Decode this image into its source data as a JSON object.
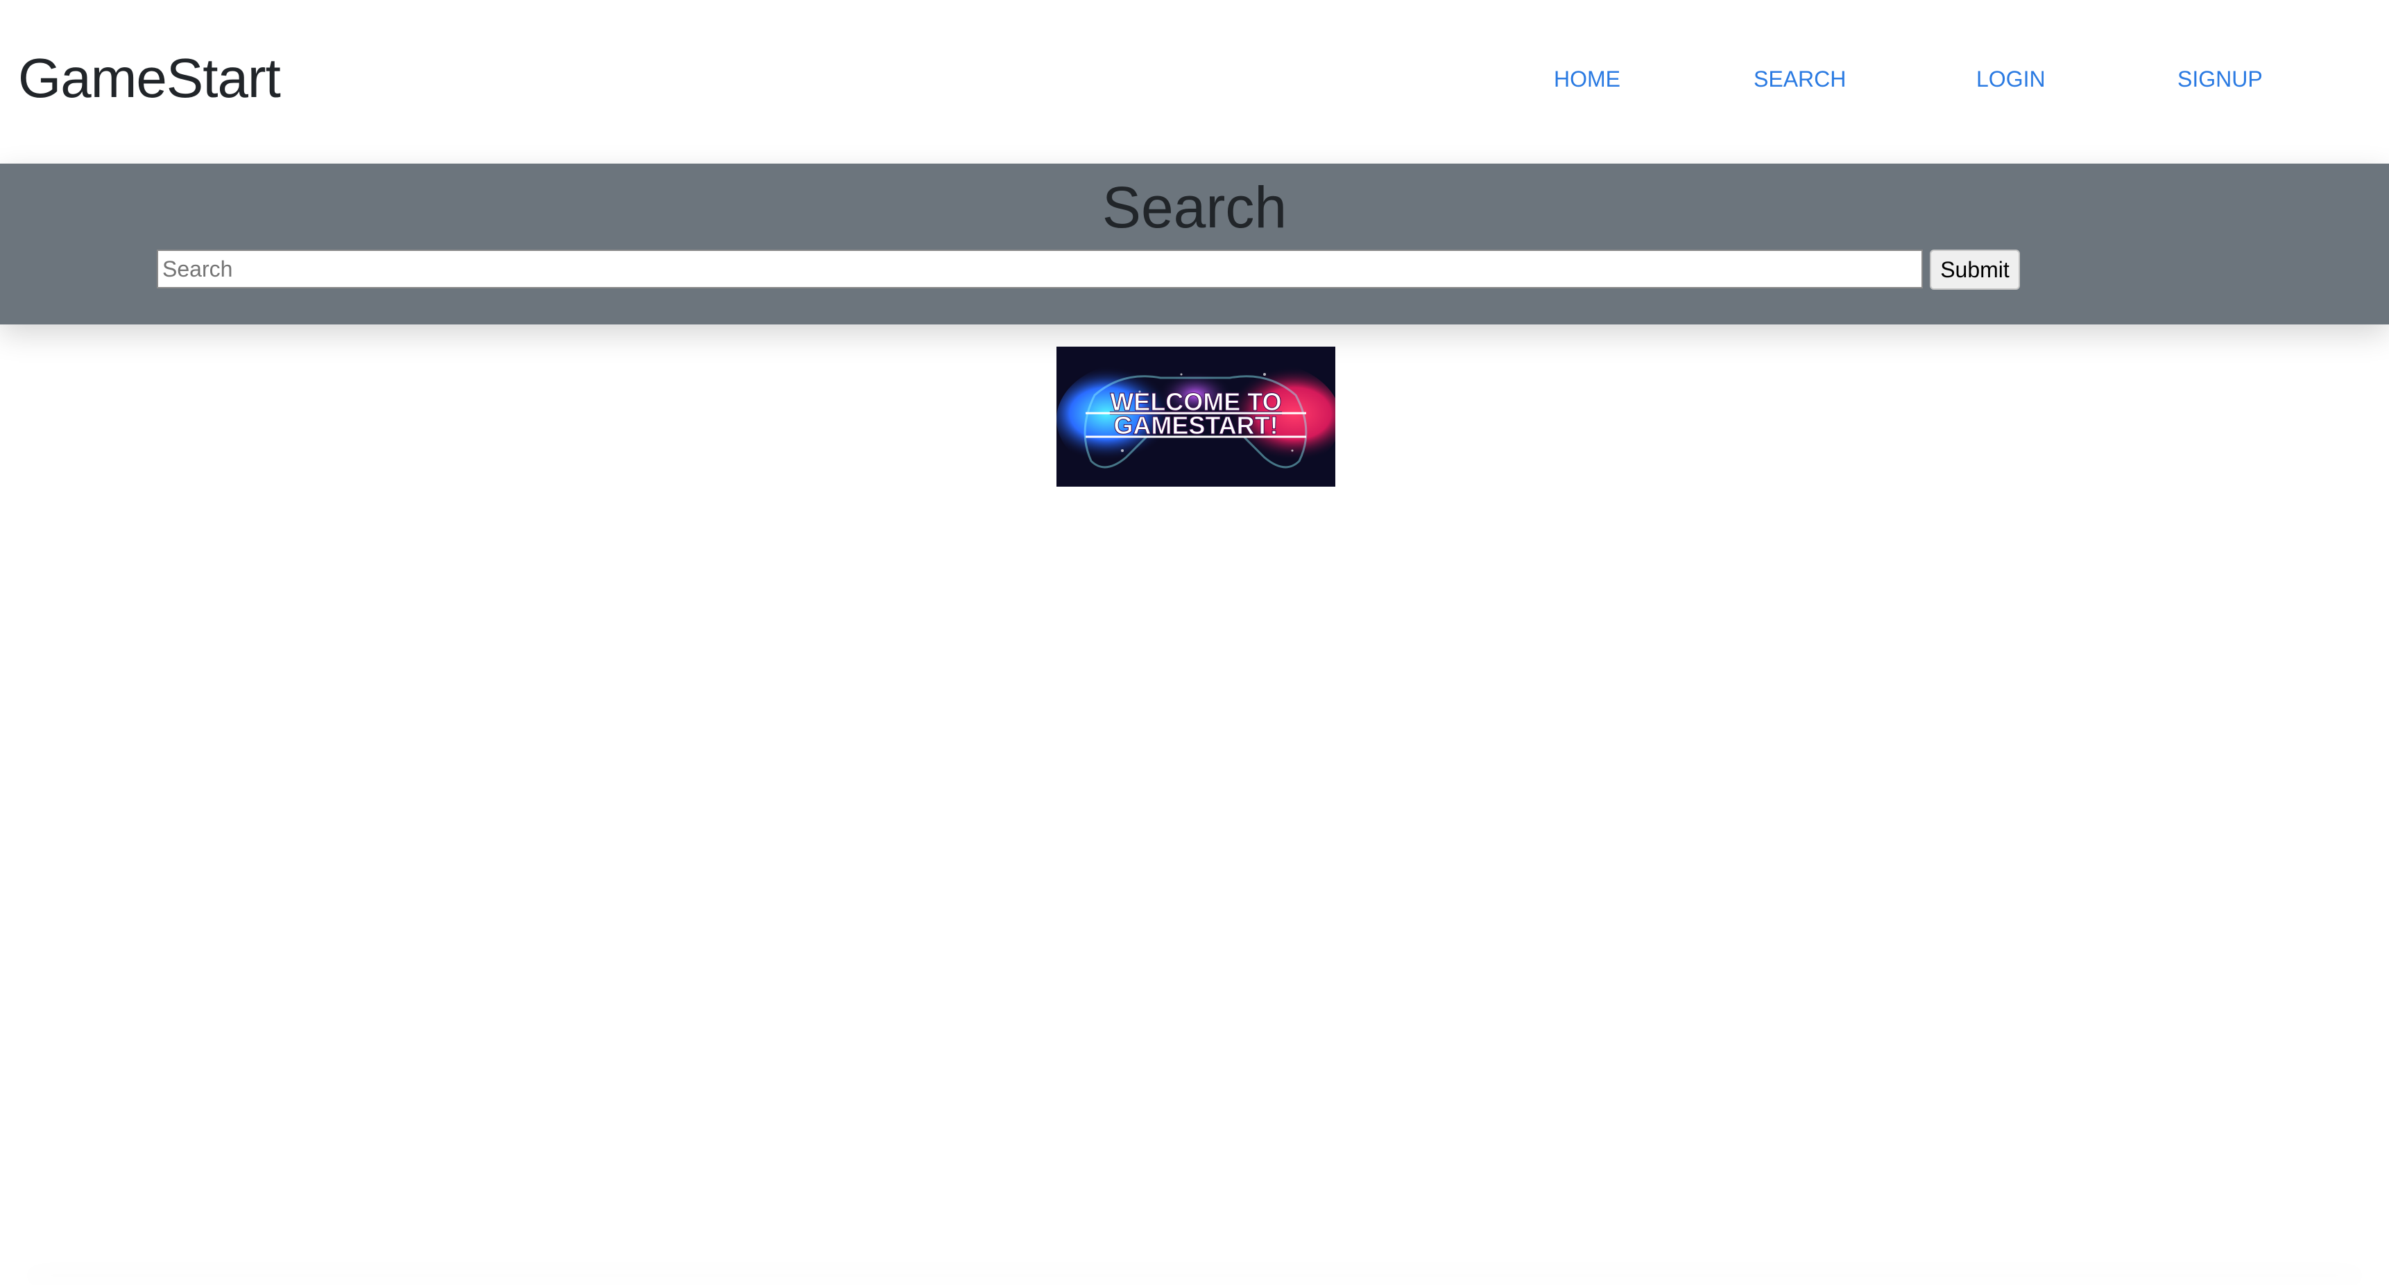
{
  "navbar": {
    "brand": "GameStart",
    "links": [
      {
        "label": "HOME"
      },
      {
        "label": "SEARCH"
      },
      {
        "label": "LOGIN"
      },
      {
        "label": "SIGNUP"
      }
    ],
    "link_color": "#2a7ae2"
  },
  "search_section": {
    "title": "Search",
    "input": {
      "placeholder": "Search",
      "value": ""
    },
    "submit_label": "Submit",
    "background_color": "#6c757d"
  },
  "banner": {
    "text_line1": "WELCOME TO",
    "text_line2": "GAMESTART!",
    "icon": "gamepad-icon"
  }
}
